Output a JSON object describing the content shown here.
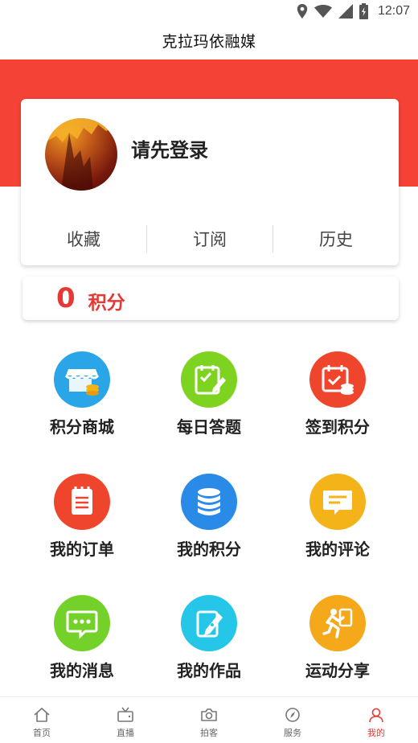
{
  "status_bar": {
    "time": "12:07"
  },
  "app": {
    "title": "克拉玛依融媒"
  },
  "profile": {
    "login_prompt": "请先登录",
    "links": [
      "收藏",
      "订阅",
      "历史"
    ]
  },
  "points": {
    "value": "0",
    "label": "积分"
  },
  "grid": [
    {
      "label": "积分商城",
      "icon": "store-icon",
      "color": "#2aa5e8"
    },
    {
      "label": "每日答题",
      "icon": "quiz-checklist-icon",
      "color": "#7ed321"
    },
    {
      "label": "签到积分",
      "icon": "calendar-checkin-icon",
      "color": "#f0452d"
    },
    {
      "label": "我的订单",
      "icon": "order-notepad-icon",
      "color": "#f0452d"
    },
    {
      "label": "我的积分",
      "icon": "coin-stack-icon",
      "color": "#2a8ae8"
    },
    {
      "label": "我的评论",
      "icon": "comment-bubble-icon",
      "color": "#f5b31a"
    },
    {
      "label": "我的消息",
      "icon": "message-bubble-icon",
      "color": "#74d12a"
    },
    {
      "label": "我的作品",
      "icon": "pen-document-icon",
      "color": "#26c6e8"
    },
    {
      "label": "运动分享",
      "icon": "running-person-icon",
      "color": "#f5a81a"
    }
  ],
  "tabs": [
    {
      "label": "首页",
      "icon": "home-icon"
    },
    {
      "label": "直播",
      "icon": "tv-icon"
    },
    {
      "label": "拍客",
      "icon": "camera-icon"
    },
    {
      "label": "服务",
      "icon": "compass-icon"
    },
    {
      "label": "我的",
      "icon": "person-icon",
      "active": true
    }
  ],
  "colors": {
    "accent": "#f44336",
    "points_red": "#e53935"
  }
}
